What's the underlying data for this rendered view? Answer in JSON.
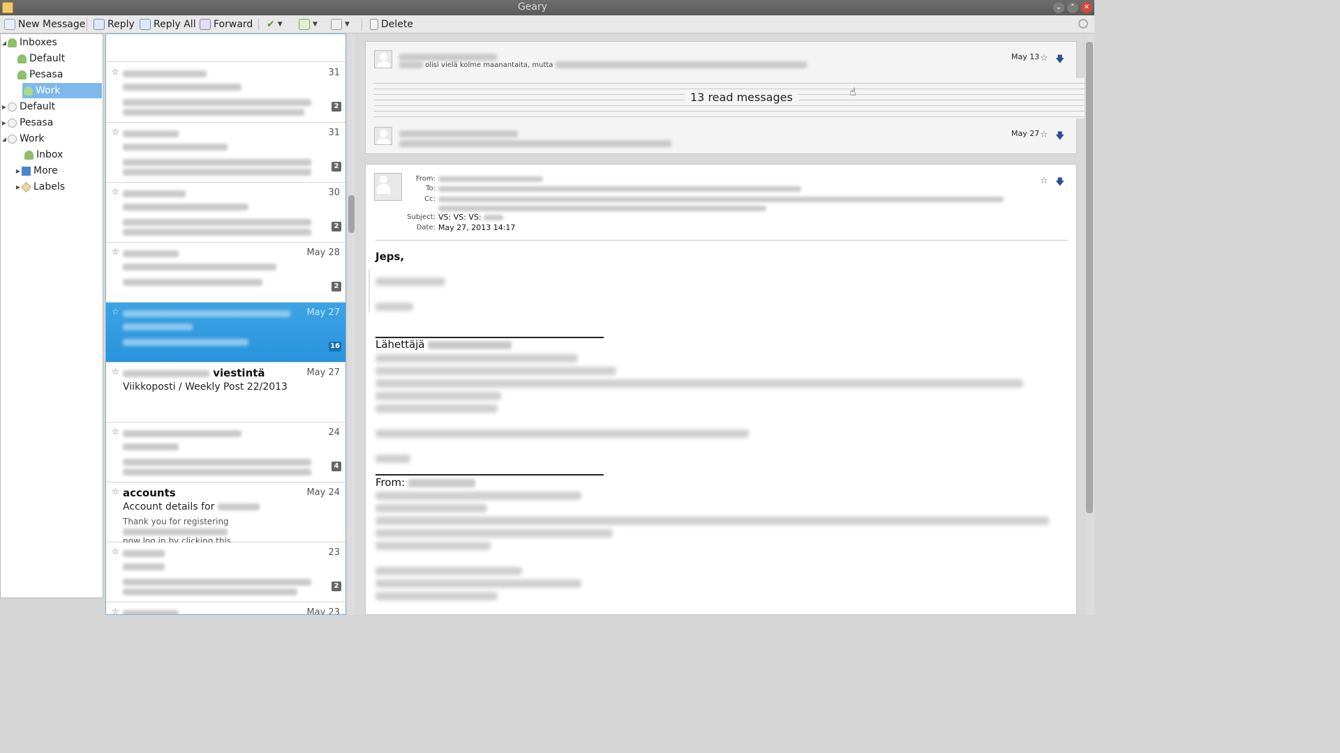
{
  "window": {
    "title": "Geary"
  },
  "toolbar": {
    "new_message": "New Message",
    "reply": "Reply",
    "reply_all": "Reply All",
    "forward": "Forward",
    "delete": "Delete"
  },
  "folders": {
    "inboxes": "Inboxes",
    "inbox_default": "Default",
    "inbox_pesasa": "Pesasa",
    "inbox_work": "Work",
    "acct_default": "Default",
    "acct_pesasa": "Pesasa",
    "acct_work": "Work",
    "work_inbox": "Inbox",
    "work_more": "More",
    "work_labels": "Labels"
  },
  "messages": [
    {
      "date": "31",
      "count": "2"
    },
    {
      "date": "31",
      "count": "2"
    },
    {
      "date": "30",
      "count": "2"
    },
    {
      "date": "May 28",
      "count": "2"
    },
    {
      "date": "May 27",
      "count": "16"
    },
    {
      "from": "viestintä",
      "date": "May 27",
      "subject": "Viikkoposti / Weekly Post 22/2013"
    },
    {
      "date": "24",
      "count": "4"
    },
    {
      "from": "accounts",
      "date": "May 24",
      "subject": "Account details for",
      "preview_1": "Thank you for registering",
      "preview_2": "now log in by clicking this"
    },
    {
      "date": "23",
      "count": "2"
    },
    {
      "date": "May 23"
    }
  ],
  "conversation": {
    "first": {
      "date": "May 13",
      "snippet": "olisi vielä kolme maanantaita, mutta"
    },
    "collapsed_label": "13 read messages",
    "second": {
      "date": "May 27"
    },
    "email": {
      "labels": {
        "from": "From:",
        "to": "To:",
        "cc": "Cc:",
        "subject": "Subject:",
        "date": "Date:"
      },
      "subject": "VS: VS: VS:",
      "date": "May 27, 2013 14:17",
      "greeting": "Jeps,",
      "sender_label": "Lähettäjä",
      "from_label": "From:"
    }
  }
}
